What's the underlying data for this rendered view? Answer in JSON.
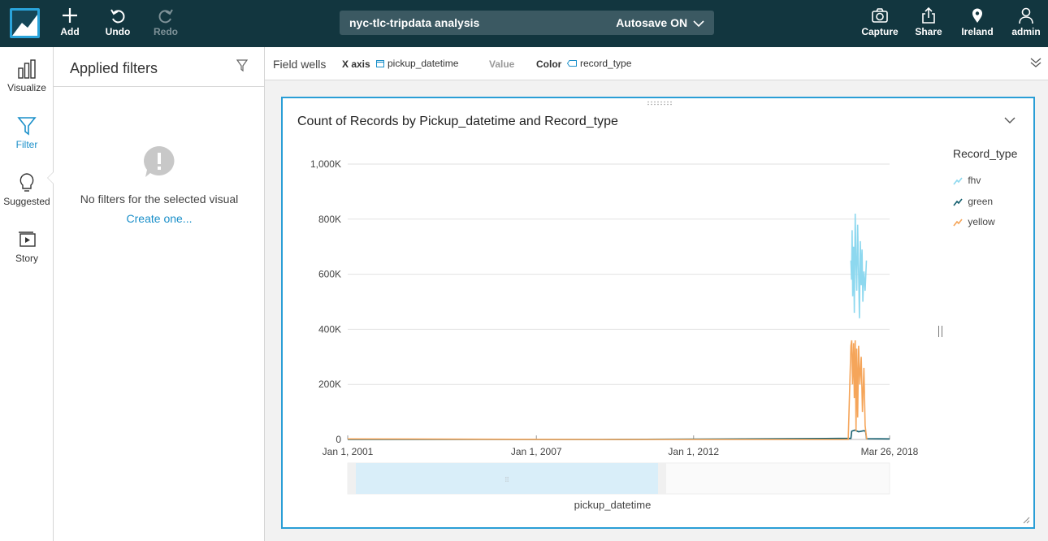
{
  "toolbar": {
    "add_label": "Add",
    "undo_label": "Undo",
    "redo_label": "Redo",
    "analysis_name": "nyc-tlc-tripdata analysis",
    "autosave_label": "Autosave ON",
    "capture_label": "Capture",
    "share_label": "Share",
    "region_label": "Ireland",
    "user_label": "admin"
  },
  "nav": {
    "items": [
      {
        "label": "Visualize",
        "icon": "bar-chart-icon"
      },
      {
        "label": "Filter",
        "icon": "funnel-icon",
        "active": true
      },
      {
        "label": "Suggested",
        "icon": "lightbulb-icon"
      },
      {
        "label": "Story",
        "icon": "story-icon"
      }
    ]
  },
  "filters": {
    "title": "Applied filters",
    "empty_message": "No filters for the selected visual",
    "create_link": "Create one..."
  },
  "field_wells": {
    "label": "Field wells",
    "x_axis_key": "X axis",
    "x_axis_value": "pickup_datetime",
    "value_key": "Value",
    "color_key": "Color",
    "color_value": "record_type"
  },
  "visual": {
    "title": "Count of Records by Pickup_datetime and Record_type",
    "legend_title": "Record_type"
  },
  "chart_data": {
    "type": "line",
    "title": "Count of Records by Pickup_datetime and Record_type",
    "xlabel": "pickup_datetime",
    "ylabel": "",
    "x_tick_labels": [
      "Jan 1, 2001",
      "Jan 1, 2007",
      "Jan 1, 2012",
      "Mar 26, 2018"
    ],
    "x_range": [
      "2001-01-01",
      "2018-03-26"
    ],
    "y_tick_labels": [
      "0",
      "200K",
      "400K",
      "600K",
      "800K",
      "1,000K"
    ],
    "ylim": [
      0,
      1000000
    ],
    "y_ticks": [
      0,
      200000,
      400000,
      600000,
      800000,
      1000000
    ],
    "grid": true,
    "legend_position": "right",
    "series": [
      {
        "name": "fhv",
        "color": "#8dd8ef",
        "points": [
          [
            "2017-01-01",
            650000
          ],
          [
            "2017-01-08",
            580000
          ],
          [
            "2017-01-15",
            760000
          ],
          [
            "2017-01-22",
            520000
          ],
          [
            "2017-02-01",
            700000
          ],
          [
            "2017-02-10",
            460000
          ],
          [
            "2017-02-20",
            820000
          ],
          [
            "2017-03-01",
            640000
          ],
          [
            "2017-03-10",
            540000
          ],
          [
            "2017-03-20",
            780000
          ],
          [
            "2017-04-01",
            600000
          ],
          [
            "2017-04-10",
            440000
          ],
          [
            "2017-04-20",
            720000
          ],
          [
            "2017-05-01",
            560000
          ],
          [
            "2017-05-10",
            690000
          ],
          [
            "2017-05-20",
            500000
          ],
          [
            "2017-06-01",
            610000
          ],
          [
            "2017-06-15",
            540000
          ],
          [
            "2017-06-30",
            650000
          ]
        ]
      },
      {
        "name": "green",
        "color": "#135e6e",
        "points": [
          [
            "2001-01-01",
            0
          ],
          [
            "2009-01-01",
            0
          ],
          [
            "2013-08-01",
            2000
          ],
          [
            "2017-01-01",
            4000
          ],
          [
            "2017-01-10",
            30000
          ],
          [
            "2017-02-15",
            34000
          ],
          [
            "2017-04-01",
            28000
          ],
          [
            "2017-06-01",
            32000
          ],
          [
            "2017-06-20",
            30000
          ],
          [
            "2017-07-01",
            3000
          ],
          [
            "2018-03-26",
            2000
          ]
        ]
      },
      {
        "name": "yellow",
        "color": "#f5a55a",
        "points": [
          [
            "2001-01-01",
            2000
          ],
          [
            "2009-01-01",
            0
          ],
          [
            "2016-12-01",
            0
          ],
          [
            "2017-01-01",
            340000
          ],
          [
            "2017-01-10",
            360000
          ],
          [
            "2017-01-20",
            200000
          ],
          [
            "2017-02-01",
            350000
          ],
          [
            "2017-02-10",
            150000
          ],
          [
            "2017-02-20",
            360000
          ],
          [
            "2017-03-01",
            30000
          ],
          [
            "2017-03-10",
            330000
          ],
          [
            "2017-03-20",
            80000
          ],
          [
            "2017-04-01",
            340000
          ],
          [
            "2017-04-15",
            200000
          ],
          [
            "2017-05-01",
            300000
          ],
          [
            "2017-05-15",
            100000
          ],
          [
            "2017-06-01",
            260000
          ],
          [
            "2017-06-15",
            50000
          ],
          [
            "2017-06-30",
            10000
          ],
          [
            "2017-07-05",
            0
          ]
        ]
      }
    ]
  }
}
